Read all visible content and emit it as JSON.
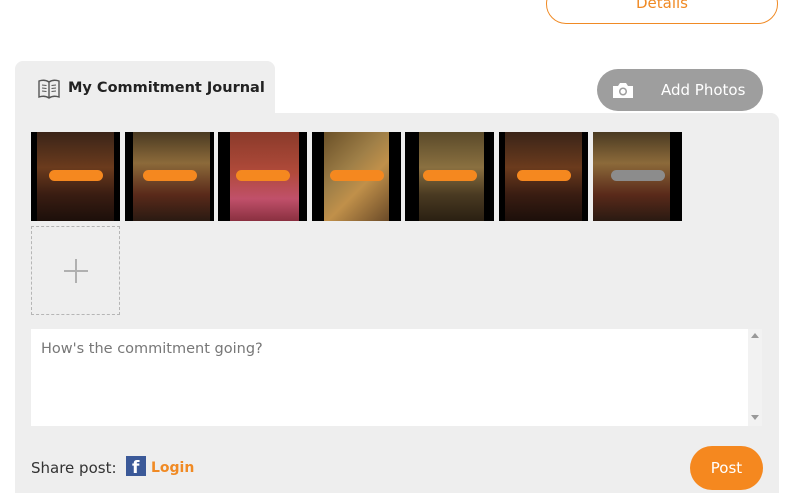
{
  "header": {
    "details_label": "Details"
  },
  "journal": {
    "title": "My Commitment Journal"
  },
  "toolbar": {
    "add_photos_label": "Add Photos"
  },
  "photos": [
    {
      "name": "photo-1",
      "bar_color": "#f5881f"
    },
    {
      "name": "photo-2",
      "bar_color": "#f5881f"
    },
    {
      "name": "photo-3",
      "bar_color": "#f5881f"
    },
    {
      "name": "photo-4",
      "bar_color": "#f5881f"
    },
    {
      "name": "photo-5",
      "bar_color": "#f5881f"
    },
    {
      "name": "photo-6",
      "bar_color": "#f5881f"
    },
    {
      "name": "photo-7",
      "bar_color": "#8c8c8c"
    }
  ],
  "post": {
    "placeholder": "How's the commitment going?",
    "share_label": "Share post:",
    "login_label": "Login",
    "post_label": "Post"
  },
  "colors": {
    "accent": "#f5881f",
    "panel": "#eeeeee",
    "facebook": "#3b5998"
  }
}
